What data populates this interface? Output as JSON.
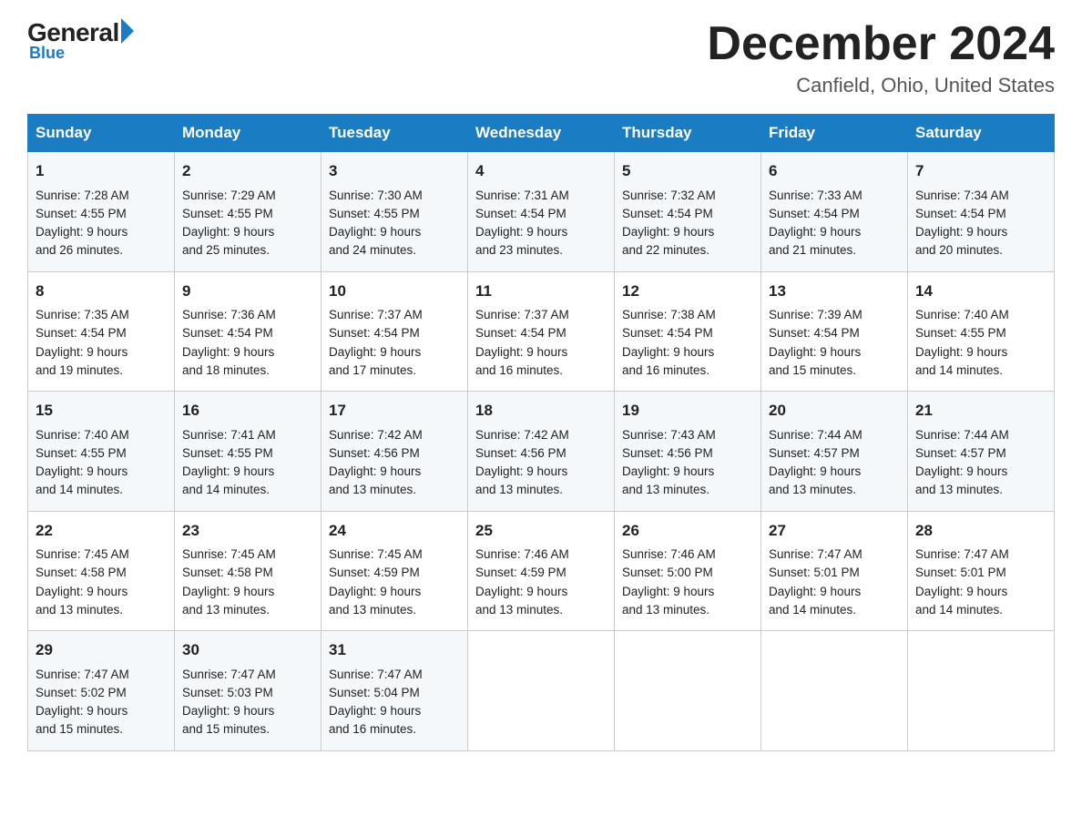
{
  "logo": {
    "general": "General",
    "blue": "Blue"
  },
  "title": "December 2024",
  "location": "Canfield, Ohio, United States",
  "days_of_week": [
    "Sunday",
    "Monday",
    "Tuesday",
    "Wednesday",
    "Thursday",
    "Friday",
    "Saturday"
  ],
  "weeks": [
    [
      {
        "day": "1",
        "sunrise": "7:28 AM",
        "sunset": "4:55 PM",
        "daylight": "9 hours and 26 minutes."
      },
      {
        "day": "2",
        "sunrise": "7:29 AM",
        "sunset": "4:55 PM",
        "daylight": "9 hours and 25 minutes."
      },
      {
        "day": "3",
        "sunrise": "7:30 AM",
        "sunset": "4:55 PM",
        "daylight": "9 hours and 24 minutes."
      },
      {
        "day": "4",
        "sunrise": "7:31 AM",
        "sunset": "4:54 PM",
        "daylight": "9 hours and 23 minutes."
      },
      {
        "day": "5",
        "sunrise": "7:32 AM",
        "sunset": "4:54 PM",
        "daylight": "9 hours and 22 minutes."
      },
      {
        "day": "6",
        "sunrise": "7:33 AM",
        "sunset": "4:54 PM",
        "daylight": "9 hours and 21 minutes."
      },
      {
        "day": "7",
        "sunrise": "7:34 AM",
        "sunset": "4:54 PM",
        "daylight": "9 hours and 20 minutes."
      }
    ],
    [
      {
        "day": "8",
        "sunrise": "7:35 AM",
        "sunset": "4:54 PM",
        "daylight": "9 hours and 19 minutes."
      },
      {
        "day": "9",
        "sunrise": "7:36 AM",
        "sunset": "4:54 PM",
        "daylight": "9 hours and 18 minutes."
      },
      {
        "day": "10",
        "sunrise": "7:37 AM",
        "sunset": "4:54 PM",
        "daylight": "9 hours and 17 minutes."
      },
      {
        "day": "11",
        "sunrise": "7:37 AM",
        "sunset": "4:54 PM",
        "daylight": "9 hours and 16 minutes."
      },
      {
        "day": "12",
        "sunrise": "7:38 AM",
        "sunset": "4:54 PM",
        "daylight": "9 hours and 16 minutes."
      },
      {
        "day": "13",
        "sunrise": "7:39 AM",
        "sunset": "4:54 PM",
        "daylight": "9 hours and 15 minutes."
      },
      {
        "day": "14",
        "sunrise": "7:40 AM",
        "sunset": "4:55 PM",
        "daylight": "9 hours and 14 minutes."
      }
    ],
    [
      {
        "day": "15",
        "sunrise": "7:40 AM",
        "sunset": "4:55 PM",
        "daylight": "9 hours and 14 minutes."
      },
      {
        "day": "16",
        "sunrise": "7:41 AM",
        "sunset": "4:55 PM",
        "daylight": "9 hours and 14 minutes."
      },
      {
        "day": "17",
        "sunrise": "7:42 AM",
        "sunset": "4:56 PM",
        "daylight": "9 hours and 13 minutes."
      },
      {
        "day": "18",
        "sunrise": "7:42 AM",
        "sunset": "4:56 PM",
        "daylight": "9 hours and 13 minutes."
      },
      {
        "day": "19",
        "sunrise": "7:43 AM",
        "sunset": "4:56 PM",
        "daylight": "9 hours and 13 minutes."
      },
      {
        "day": "20",
        "sunrise": "7:44 AM",
        "sunset": "4:57 PM",
        "daylight": "9 hours and 13 minutes."
      },
      {
        "day": "21",
        "sunrise": "7:44 AM",
        "sunset": "4:57 PM",
        "daylight": "9 hours and 13 minutes."
      }
    ],
    [
      {
        "day": "22",
        "sunrise": "7:45 AM",
        "sunset": "4:58 PM",
        "daylight": "9 hours and 13 minutes."
      },
      {
        "day": "23",
        "sunrise": "7:45 AM",
        "sunset": "4:58 PM",
        "daylight": "9 hours and 13 minutes."
      },
      {
        "day": "24",
        "sunrise": "7:45 AM",
        "sunset": "4:59 PM",
        "daylight": "9 hours and 13 minutes."
      },
      {
        "day": "25",
        "sunrise": "7:46 AM",
        "sunset": "4:59 PM",
        "daylight": "9 hours and 13 minutes."
      },
      {
        "day": "26",
        "sunrise": "7:46 AM",
        "sunset": "5:00 PM",
        "daylight": "9 hours and 13 minutes."
      },
      {
        "day": "27",
        "sunrise": "7:47 AM",
        "sunset": "5:01 PM",
        "daylight": "9 hours and 14 minutes."
      },
      {
        "day": "28",
        "sunrise": "7:47 AM",
        "sunset": "5:01 PM",
        "daylight": "9 hours and 14 minutes."
      }
    ],
    [
      {
        "day": "29",
        "sunrise": "7:47 AM",
        "sunset": "5:02 PM",
        "daylight": "9 hours and 15 minutes."
      },
      {
        "day": "30",
        "sunrise": "7:47 AM",
        "sunset": "5:03 PM",
        "daylight": "9 hours and 15 minutes."
      },
      {
        "day": "31",
        "sunrise": "7:47 AM",
        "sunset": "5:04 PM",
        "daylight": "9 hours and 16 minutes."
      },
      null,
      null,
      null,
      null
    ]
  ],
  "cell_labels": {
    "sunrise": "Sunrise:",
    "sunset": "Sunset:",
    "daylight": "Daylight:"
  }
}
